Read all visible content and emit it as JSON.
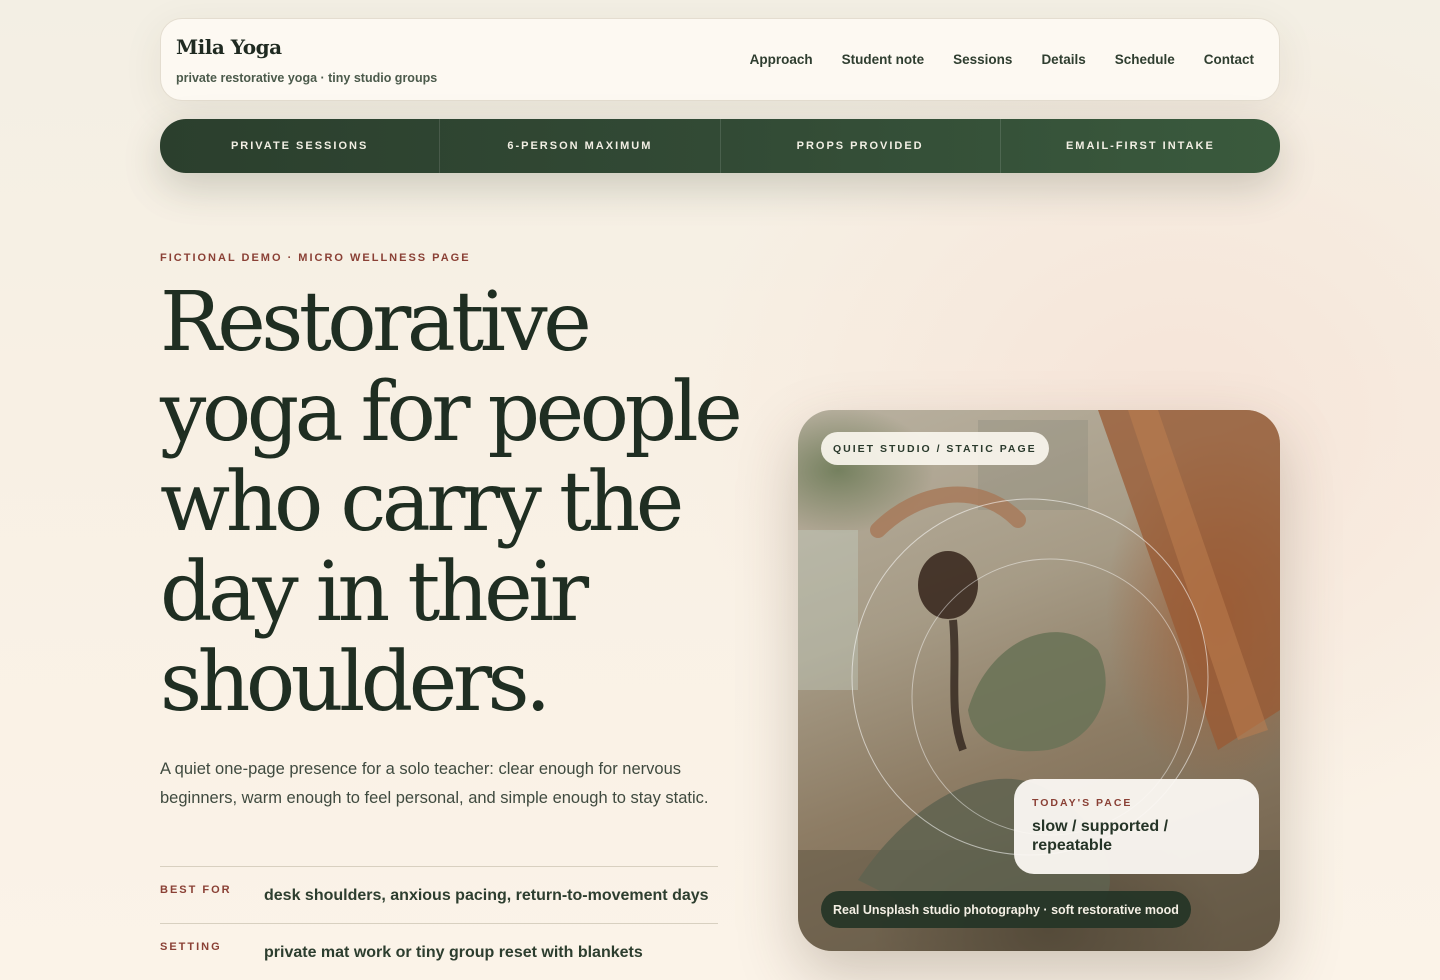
{
  "brand": {
    "name": "Mila Yoga",
    "tagline": "private restorative yoga · tiny studio groups"
  },
  "nav": {
    "items": [
      "Approach",
      "Student note",
      "Sessions",
      "Details",
      "Schedule",
      "Contact"
    ]
  },
  "highlights": [
    "PRIVATE SESSIONS",
    "6-PERSON MAXIMUM",
    "PROPS PROVIDED",
    "EMAIL-FIRST INTAKE"
  ],
  "hero": {
    "eyebrow": "FICTIONAL DEMO · MICRO WELLNESS PAGE",
    "headline": "Restorative yoga for people who carry the day in their shoulders.",
    "lede": "A quiet one-page presence for a solo teacher: clear enough for nervous beginners, warm enough to feel personal, and simple enough to stay static."
  },
  "facts": [
    {
      "label": "BEST FOR",
      "value": "desk shoulders, anxious pacing, return-to-movement days"
    },
    {
      "label": "SETTING",
      "value": "private mat work or tiny group reset with blankets"
    }
  ],
  "photo": {
    "tag": "QUIET STUDIO / STATIC PAGE",
    "pace_label": "TODAY'S PACE",
    "pace_value": "slow / supported / repeatable",
    "caption": "Real Unsplash studio photography · soft restorative mood"
  },
  "colors": {
    "accent_green": "#2f4632",
    "accent_rust": "#8a4035",
    "background": "#f8f0e4"
  }
}
